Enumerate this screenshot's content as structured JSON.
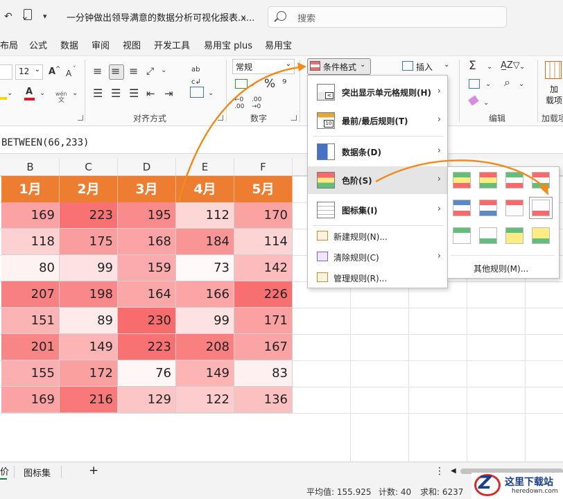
{
  "titlebar": {
    "doc_title": "一分钟做出领导满意的数据分析可视化报表.x...",
    "search_placeholder": "搜索"
  },
  "menu_tabs": [
    "布局",
    "公式",
    "数据",
    "审阅",
    "视图",
    "开发工具",
    "易用宝 plus",
    "易用宝"
  ],
  "ribbon": {
    "font_name": "",
    "font_size": "12",
    "font_group": {
      "grow": "A",
      "shrink": "A",
      "font_color": "A",
      "phonetic": "wén"
    },
    "align_label": "对齐方式",
    "number_format": "常规",
    "number_label": "数字",
    "cond_format_btn": "条件格式",
    "insert_btn": "插入",
    "edit_label": "编辑",
    "addin_top": "加",
    "addin_mid": "载项",
    "addin_label": "加载项"
  },
  "formula": "BETWEEN(66,233)",
  "columns": [
    "B",
    "C",
    "D",
    "E",
    "F"
  ],
  "months": [
    "1月",
    "2月",
    "3月",
    "4月",
    "5月"
  ],
  "rows": [
    [
      169,
      223,
      195,
      112,
      170
    ],
    [
      118,
      175,
      168,
      184,
      114
    ],
    [
      80,
      99,
      159,
      73,
      142
    ],
    [
      207,
      198,
      164,
      166,
      226
    ],
    [
      151,
      89,
      230,
      99,
      171
    ],
    [
      201,
      149,
      223,
      208,
      167
    ],
    [
      155,
      172,
      76,
      149,
      83
    ],
    [
      169,
      216,
      129,
      122,
      136
    ]
  ],
  "accent": "#ed7d31",
  "scale_low": "#ffffff",
  "scale_high": "#f8696b",
  "menu": {
    "items": [
      "突出显示单元格规则(H)",
      "最前/最后规则(T)",
      "数据条(D)",
      "色阶(S)",
      "图标集(I)"
    ],
    "small": [
      "新建规则(N)...",
      "清除规则(C)",
      "管理规则(R)..."
    ]
  },
  "submenu": {
    "more": "其他规则(M)..."
  },
  "sheet_tabs": {
    "first": "价",
    "second": "图标集",
    "add": "+"
  },
  "status": {
    "avg": "平均值: 155.925",
    "count": "计数: 40",
    "sum": "求和: 6237"
  },
  "watermark": {
    "name": "这里下载站",
    "url": "heredown.com",
    "logo": "Z"
  }
}
